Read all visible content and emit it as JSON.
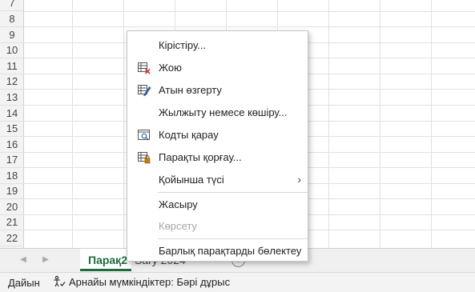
{
  "grid": {
    "row_numbers": [
      "7",
      "8",
      "9",
      "10",
      "11",
      "12",
      "13",
      "14",
      "15",
      "16",
      "17",
      "18",
      "19",
      "20",
      "21",
      "22"
    ]
  },
  "context_menu": {
    "items": [
      {
        "label": "Кірістіру...",
        "icon": "none",
        "disabled": false
      },
      {
        "label": "Жою",
        "icon": "delete-sheet-icon",
        "disabled": false
      },
      {
        "label": "Атын өзгерту",
        "icon": "rename-sheet-icon",
        "disabled": false
      },
      {
        "label": "Жылжыту немесе көшіру...",
        "icon": "none",
        "disabled": false
      },
      {
        "label": "Кодты қарау",
        "icon": "view-code-icon",
        "disabled": false
      },
      {
        "label": "Парақты қорғау...",
        "icon": "protect-sheet-icon",
        "disabled": false
      },
      {
        "label": "Қойынша түсі",
        "icon": "none",
        "disabled": false,
        "submenu": true
      },
      {
        "label": "Жасыру",
        "icon": "none",
        "disabled": false
      },
      {
        "label": "Көрсету",
        "icon": "none",
        "disabled": true
      },
      {
        "label": "Барлық парақтарды бөлектеу",
        "icon": "none",
        "disabled": false
      }
    ]
  },
  "sheet_tabs": {
    "active": "Парақ2",
    "other_partial": "Sary 2024"
  },
  "status_bar": {
    "ready": "Дайын",
    "accessibility": "Арнайы мүмкіндіктер: Бәрі дұрыс"
  },
  "colors": {
    "accent_green": "#1e6b3c",
    "delete_red": "#d13438",
    "lock_orange": "#c87d0e",
    "edit_blue": "#2b6cb0"
  }
}
